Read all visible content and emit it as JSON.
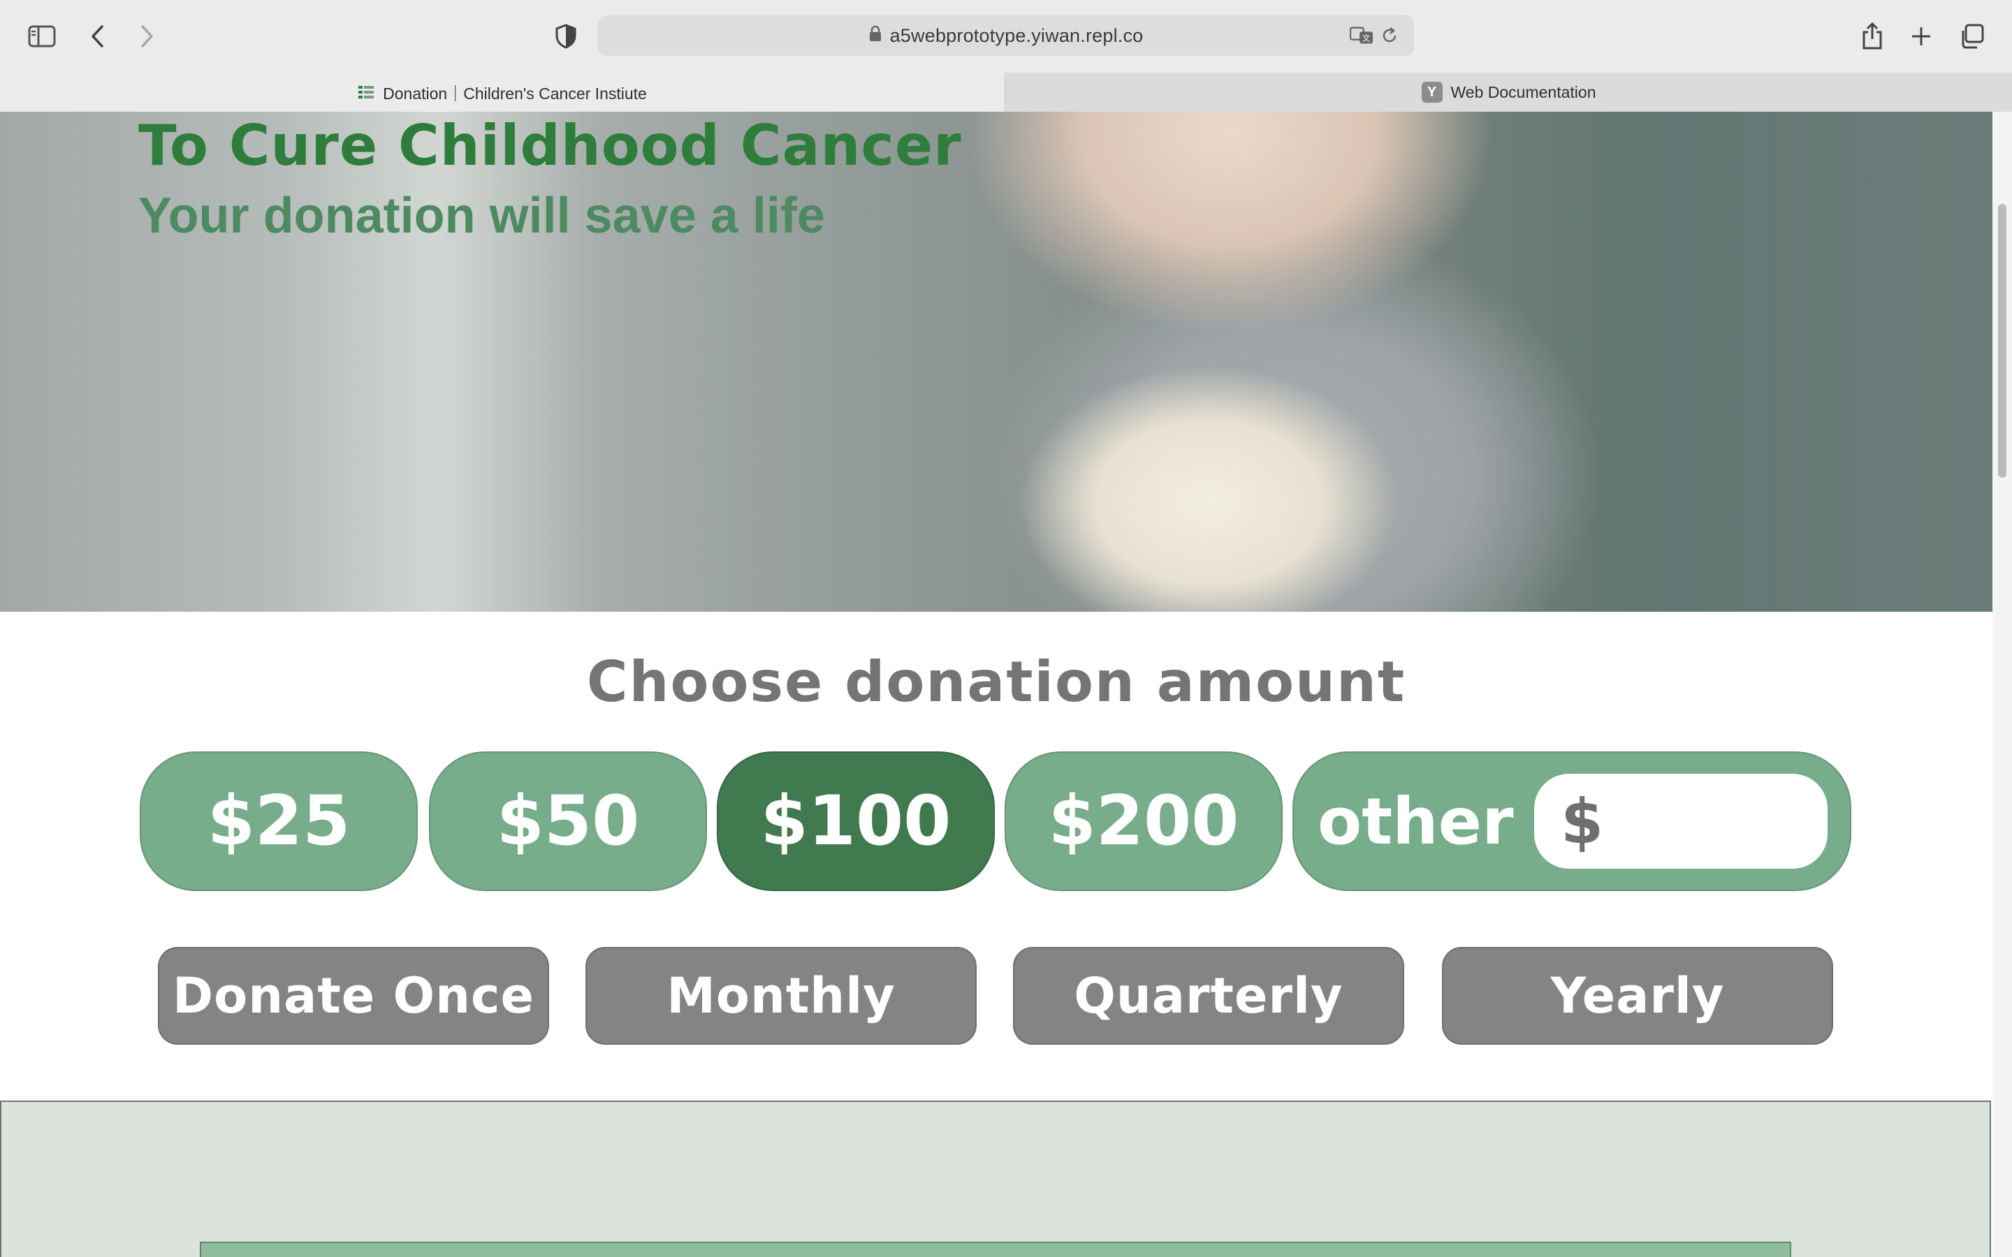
{
  "browser": {
    "url": "a5webprototype.yiwan.repl.co",
    "tabs": [
      {
        "label": "Donation｜Children's Cancer Instiute",
        "active": true
      },
      {
        "label": "Web Documentation",
        "active": false,
        "favicon_letter": "Y"
      }
    ]
  },
  "hero": {
    "title": "To Cure Childhood Cancer",
    "subtitle": "Your donation will save a life"
  },
  "donation": {
    "heading": "Choose donation amount",
    "amounts": [
      "$25",
      "$50",
      "$100",
      "$200"
    ],
    "selected_amount": "$100",
    "other_label": "other",
    "other_currency": "$",
    "other_value": ""
  },
  "frequency": {
    "options": [
      "Donate Once",
      "Monthly",
      "Quarterly",
      "Yearly"
    ]
  },
  "colors": {
    "brand_green": "#2e7d3d",
    "amount_button": "#77ad8b",
    "amount_selected": "#417a4f",
    "frequency_button": "#848484"
  }
}
